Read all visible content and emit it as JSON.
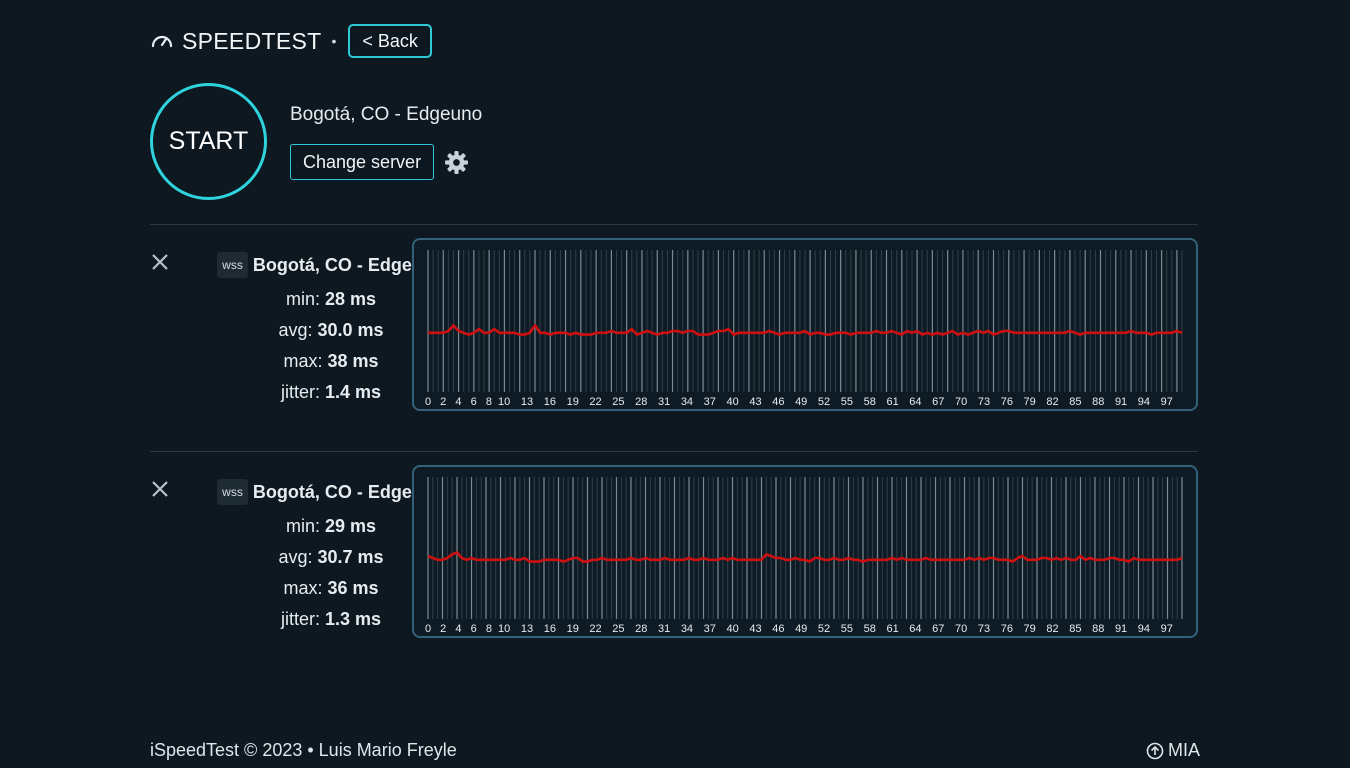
{
  "header": {
    "title": "SPEEDTEST",
    "separator": "•",
    "back_label": "< Back",
    "logo_icon": "speedometer-icon"
  },
  "start_label": "START",
  "server": {
    "name": "Bogotá, CO - Edgeuno",
    "change_label": "Change server",
    "settings_icon": "gear-icon"
  },
  "results": [
    {
      "protocol": "wss",
      "server": "Bogotá, CO - Edgeuno",
      "min_label": "min:",
      "min_value": "28 ms",
      "avg_label": "avg:",
      "avg_value": "30.0 ms",
      "max_label": "max:",
      "max_value": "38 ms",
      "jitter_label": "jitter:",
      "jitter_value": "1.4 ms"
    },
    {
      "protocol": "wss",
      "server": "Bogotá, CO - Edgeuno",
      "min_label": "min:",
      "min_value": "29 ms",
      "avg_label": "avg:",
      "avg_value": "30.7 ms",
      "max_label": "max:",
      "max_value": "36 ms",
      "jitter_label": "jitter:",
      "jitter_value": "1.3 ms"
    }
  ],
  "chart_data": [
    {
      "type": "line",
      "x_tick_labels": [
        "0",
        "2",
        "4",
        "6",
        "8",
        "10",
        "13",
        "16",
        "19",
        "22",
        "25",
        "28",
        "31",
        "34",
        "37",
        "40",
        "43",
        "46",
        "49",
        "52",
        "55",
        "58",
        "61",
        "64",
        "67",
        "70",
        "73",
        "76",
        "79",
        "82",
        "85",
        "88",
        "91",
        "94",
        "97"
      ],
      "xlim": [
        0,
        99
      ],
      "ylim": [
        0,
        75
      ],
      "line_color": "#d01010",
      "grid": true,
      "series": [
        {
          "values": [
            30,
            30,
            30,
            30,
            31,
            34,
            31,
            30,
            29,
            30,
            32,
            30,
            30,
            32,
            30,
            30,
            30,
            30,
            29,
            29,
            30,
            34,
            30,
            30,
            29,
            30,
            30,
            30,
            29,
            30,
            29,
            29,
            29,
            30,
            30,
            30,
            31,
            30,
            30,
            30,
            32,
            29,
            30,
            31,
            30,
            29,
            30,
            30,
            31,
            31,
            30,
            31,
            31,
            29,
            29,
            29,
            30,
            31,
            31,
            32,
            29,
            30,
            30,
            30,
            30,
            30,
            30,
            31,
            30,
            29,
            30,
            30,
            30,
            30,
            31,
            29,
            30,
            30,
            29,
            29,
            30,
            30,
            30,
            29,
            30,
            30,
            30,
            30,
            31,
            30,
            30,
            31,
            30,
            29,
            31,
            30,
            31,
            29,
            30,
            29,
            30,
            29,
            30,
            31,
            29,
            30,
            29,
            30,
            31,
            30,
            31,
            29,
            30,
            31,
            31,
            30,
            30,
            30,
            30,
            30,
            30,
            30,
            30,
            30,
            30,
            30,
            31,
            30,
            29,
            30,
            30,
            30,
            30,
            30,
            30,
            30,
            30,
            30,
            31,
            30,
            30,
            30,
            29,
            30,
            30,
            30,
            30,
            31,
            30
          ]
        }
      ]
    },
    {
      "type": "line",
      "x_tick_labels": [
        "0",
        "2",
        "4",
        "6",
        "8",
        "10",
        "13",
        "16",
        "19",
        "22",
        "25",
        "28",
        "31",
        "34",
        "37",
        "40",
        "43",
        "46",
        "49",
        "52",
        "55",
        "58",
        "61",
        "64",
        "67",
        "70",
        "73",
        "76",
        "79",
        "82",
        "85",
        "88",
        "91",
        "94",
        "97"
      ],
      "xlim": [
        0,
        99
      ],
      "ylim": [
        0,
        75
      ],
      "line_color": "#d01010",
      "grid": true,
      "series": [
        {
          "values": [
            32,
            31,
            30,
            30,
            31,
            33,
            34,
            31,
            30,
            31,
            30,
            30,
            30,
            30,
            30,
            30,
            30,
            31,
            30,
            30,
            31,
            29,
            29,
            29,
            30,
            30,
            30,
            30,
            29,
            30,
            31,
            31,
            29,
            29,
            30,
            30,
            31,
            30,
            30,
            30,
            30,
            30,
            31,
            30,
            30,
            31,
            30,
            30,
            30,
            31,
            30,
            30,
            30,
            30,
            31,
            30,
            30,
            31,
            30,
            30,
            30,
            31,
            30,
            31,
            30,
            30,
            30,
            30,
            30,
            30,
            33,
            32,
            31,
            31,
            30,
            30,
            31,
            30,
            30,
            29,
            31,
            31,
            30,
            30,
            31,
            30,
            30,
            31,
            30,
            30,
            29,
            30,
            30,
            30,
            30,
            30,
            31,
            30,
            31,
            30,
            30,
            30,
            30,
            31,
            30,
            30,
            30,
            30,
            30,
            30,
            30,
            30,
            31,
            30,
            31,
            30,
            31,
            31,
            30,
            30,
            30,
            29,
            31,
            32,
            30,
            30,
            30,
            31,
            31,
            30,
            31,
            30,
            31,
            30,
            30,
            32,
            30,
            31,
            30,
            30,
            30,
            31,
            31,
            30,
            30,
            29,
            31,
            30,
            30,
            30,
            30,
            30,
            30,
            30,
            30,
            30,
            31
          ]
        }
      ]
    }
  ],
  "footer": {
    "left": "iSpeedTest © 2023 • Luis Mario Freyle",
    "right": "MIA",
    "right_icon": "arrow-up-circle-icon"
  }
}
